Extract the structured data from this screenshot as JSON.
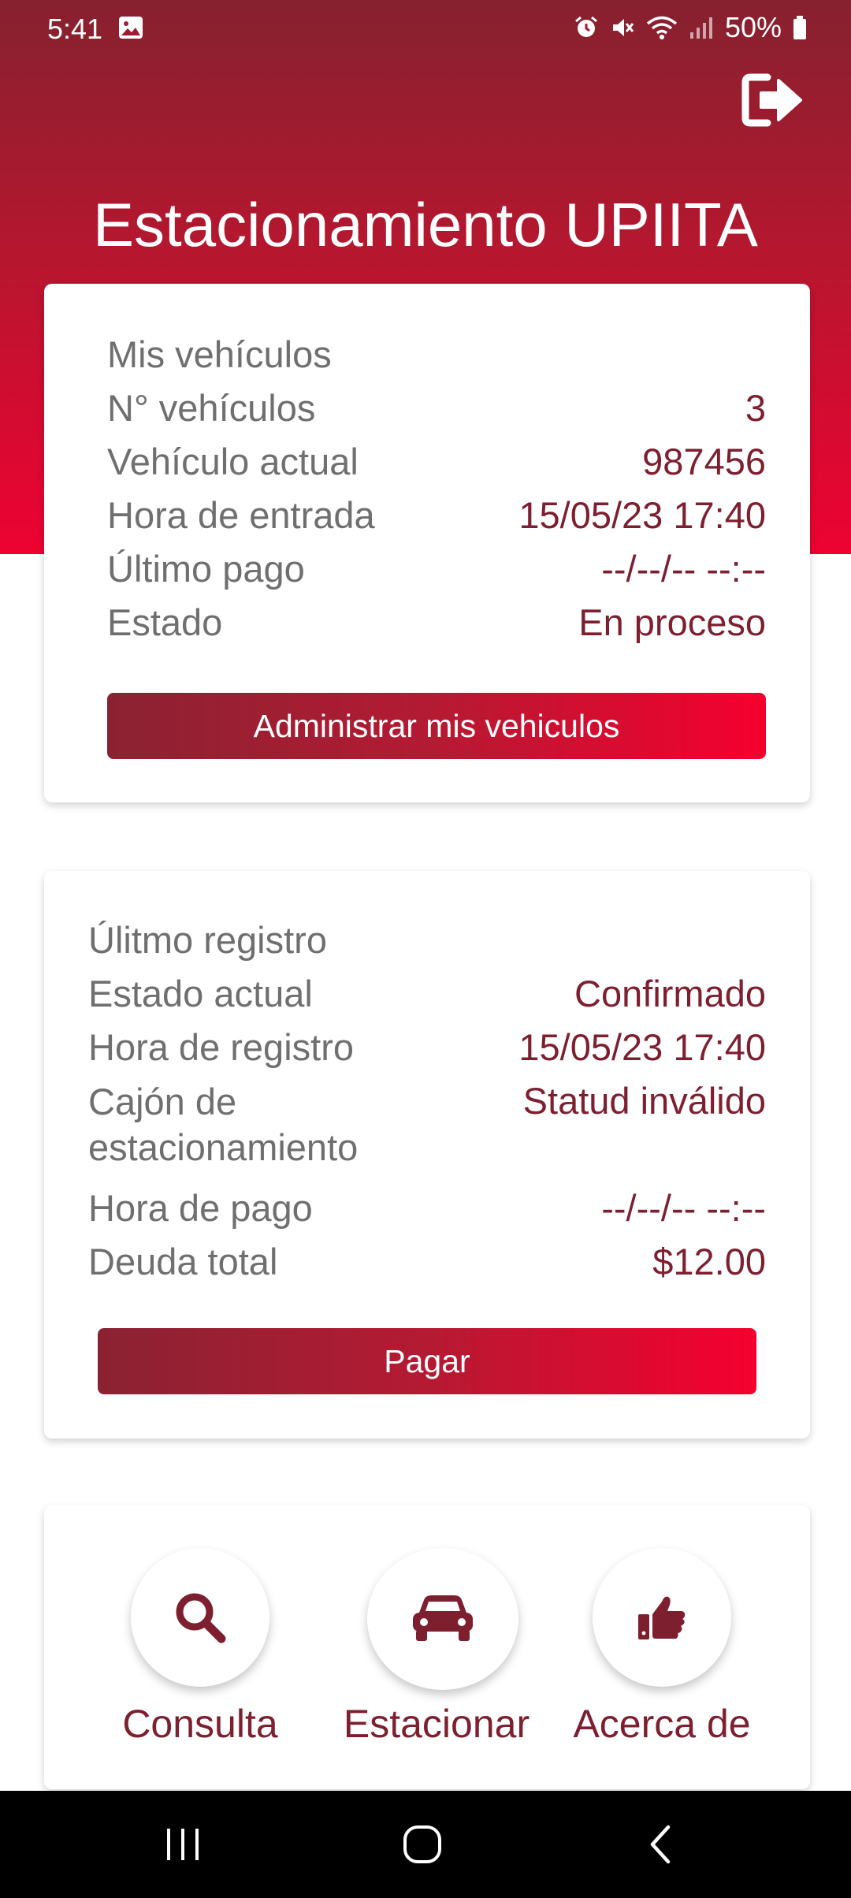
{
  "status_bar": {
    "time": "5:41",
    "battery": "50%"
  },
  "header": {
    "title": "Estacionamiento UPIITA"
  },
  "vehicles_card": {
    "heading": "Mis vehículos",
    "rows": [
      {
        "label": "N° vehículos",
        "value": "3"
      },
      {
        "label": "Vehículo actual",
        "value": "987456"
      },
      {
        "label": "Hora de entrada",
        "value": "15/05/23 17:40"
      },
      {
        "label": "Último pago",
        "value": "--/--/-- --:--"
      },
      {
        "label": "Estado",
        "value": "En proceso"
      }
    ],
    "button_label": "Administrar mis vehiculos"
  },
  "registry_card": {
    "heading": "Úlitmo registro",
    "rows": [
      {
        "label": "Estado actual",
        "value": "Confirmado"
      },
      {
        "label": "Hora de registro",
        "value": "15/05/23 17:40"
      },
      {
        "label": "Cajón de estacionamiento",
        "value": "Statud inválido"
      },
      {
        "label": "Hora de pago",
        "value": "--/--/-- --:--"
      },
      {
        "label": "Deuda total",
        "value": "$12.00"
      }
    ],
    "button_label": "Pagar"
  },
  "actions": [
    {
      "label": "Consulta",
      "icon": "search-icon"
    },
    {
      "label": "Estacionar",
      "icon": "car-icon"
    },
    {
      "label": "Acerca de",
      "icon": "thumbs-up-icon"
    }
  ],
  "colors": {
    "accent": "#7e1f30",
    "gradient_start": "#86212f",
    "gradient_end": "#ee0232"
  }
}
